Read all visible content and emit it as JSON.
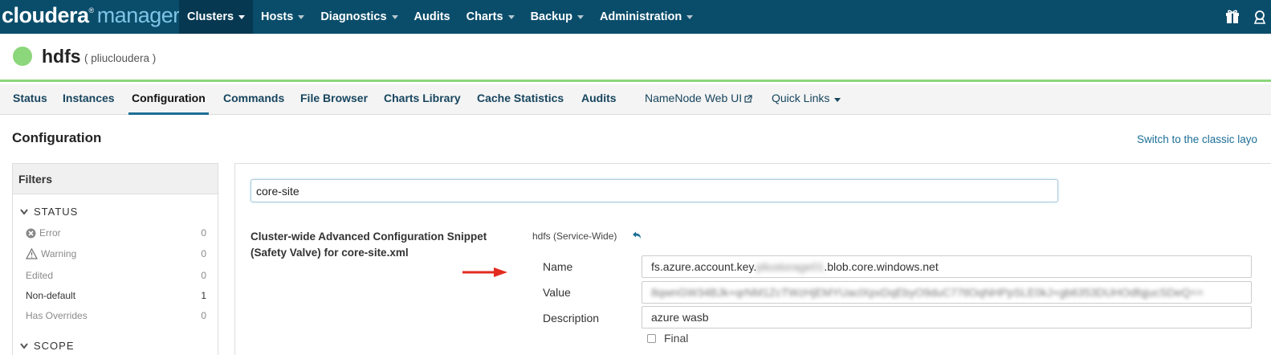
{
  "brand": {
    "part1": "cloudera",
    "reg": "®",
    "part2": "manager"
  },
  "nav": [
    {
      "label": "Clusters",
      "dropdown": true,
      "active": true
    },
    {
      "label": "Hosts",
      "dropdown": true
    },
    {
      "label": "Diagnostics",
      "dropdown": true
    },
    {
      "label": "Audits",
      "dropdown": false
    },
    {
      "label": "Charts",
      "dropdown": true
    },
    {
      "label": "Backup",
      "dropdown": true
    },
    {
      "label": "Administration",
      "dropdown": true
    }
  ],
  "service": {
    "name": "hdfs",
    "cluster": "( pliucloudera )",
    "status_color": "#8cd67b"
  },
  "tabs": [
    {
      "label": "Status"
    },
    {
      "label": "Instances"
    },
    {
      "label": "Configuration",
      "active": true
    },
    {
      "label": "Commands"
    },
    {
      "label": "File Browser"
    },
    {
      "label": "Charts Library"
    },
    {
      "label": "Cache Statistics"
    },
    {
      "label": "Audits"
    },
    {
      "label": "NameNode Web UI"
    },
    {
      "label": "Quick Links"
    }
  ],
  "page": {
    "title": "Configuration",
    "classic_link": "Switch to the classic layo"
  },
  "filters": {
    "title": "Filters",
    "status_section": "STATUS",
    "scope_section": "SCOPE",
    "items": [
      {
        "label": "Error",
        "count": "0"
      },
      {
        "label": "Warning",
        "count": "0"
      },
      {
        "label": "Edited",
        "count": "0"
      },
      {
        "label": "Non-default",
        "count": "1"
      },
      {
        "label": "Has Overrides",
        "count": "0"
      }
    ]
  },
  "search": {
    "value": "core-site"
  },
  "property": {
    "title": "Cluster-wide Advanced Configuration Snippet (Safety Valve) for core-site.xml",
    "scope": "hdfs (Service-Wide)",
    "name_label": "Name",
    "name_prefix": "fs.azure.account.key.",
    "name_hidden": "pliustorage01",
    "name_suffix": ".blob.core.windows.net",
    "value_label": "Value",
    "value_value": "8qwnGW34BJk+qrNM1ZcTWzHjEMYUaclXpxDqEbyO9duC77tlOqNHPpSLE0kJ+gb6353DUHOdfqjucSDeQ==",
    "description_label": "Description",
    "description_value": "azure wasb",
    "final_label": "Final"
  },
  "colors": {
    "navbar": "#0a4d6b",
    "accent": "#1c6e96",
    "healthy": "#8cd67b",
    "arrow": "#e32b20"
  }
}
